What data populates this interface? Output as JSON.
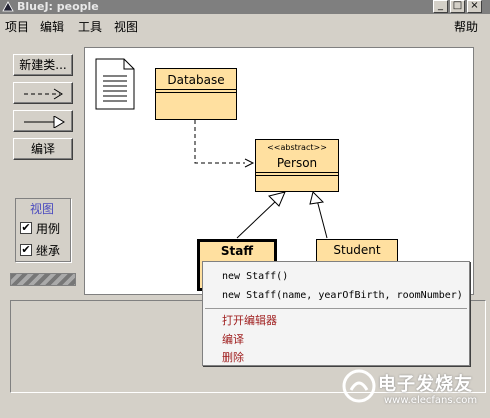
{
  "window": {
    "title": "BlueJ: people"
  },
  "menu": {
    "project": "项目",
    "edit": "编辑",
    "tools": "工具",
    "view": "视图",
    "help": "帮助"
  },
  "toolbar": {
    "new_class": "新建类...",
    "compile": "编译"
  },
  "view_panel": {
    "title": "视图",
    "uses": "用例",
    "inherits": "继承",
    "uses_checked": true,
    "inherits_checked": true
  },
  "classes": {
    "database": {
      "name": "Database"
    },
    "person": {
      "stereotype": "<<abstract>>",
      "name": "Person"
    },
    "staff": {
      "name": "Staff"
    },
    "student": {
      "name": "Student"
    }
  },
  "context_menu": {
    "constructor_1": "new Staff()",
    "constructor_2": "new Staff(name, yearOfBirth, roomNumber)",
    "open_editor": "打开编辑器",
    "compile": "编译",
    "remove": "删除"
  },
  "watermark": {
    "brand": "电子发烧友",
    "url": "www.elecfans.com"
  },
  "colors": {
    "class_fill": "#ffe0a0",
    "canvas": "#ffffff",
    "chrome": "#d4d0c8",
    "context_action": "#a02020"
  }
}
